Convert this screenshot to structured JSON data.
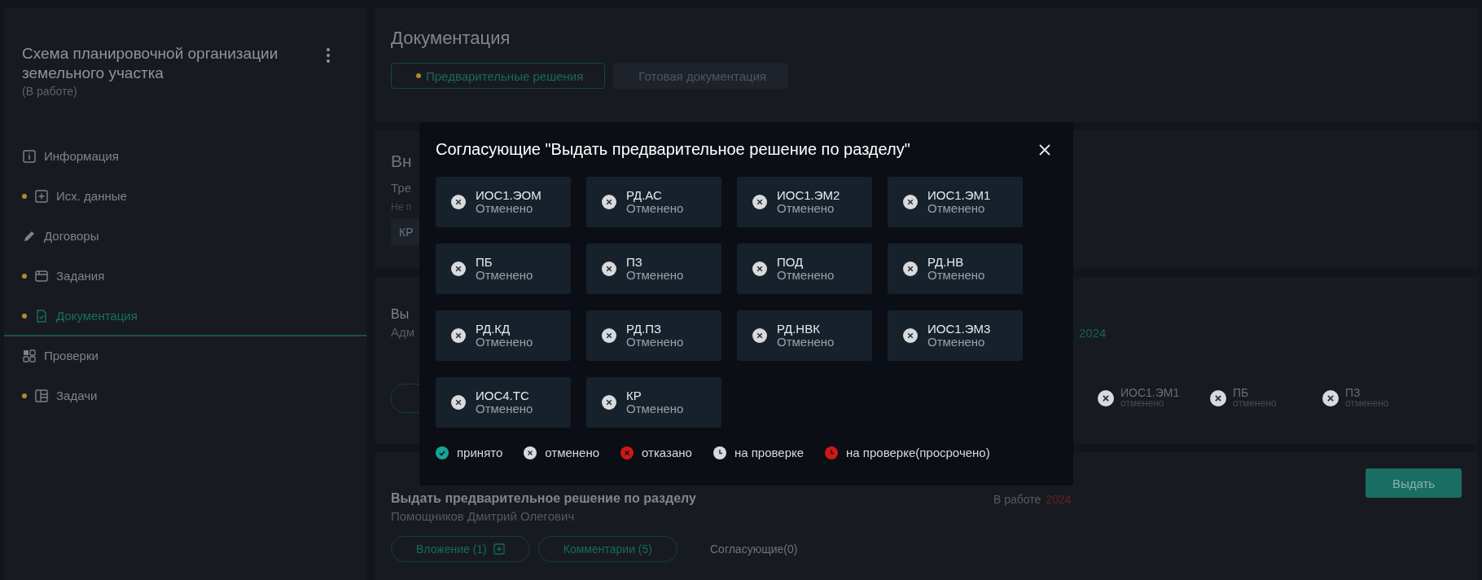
{
  "sidebar": {
    "title": "Схема планировочной организации земельного участка",
    "status": "(В работе)",
    "items": [
      {
        "label": "Информация",
        "marked": false,
        "selected": false
      },
      {
        "label": "Исх. данные",
        "marked": true,
        "selected": false
      },
      {
        "label": "Договоры",
        "marked": false,
        "selected": false
      },
      {
        "label": "Задания",
        "marked": true,
        "selected": false
      },
      {
        "label": "Документация",
        "marked": true,
        "selected": true
      },
      {
        "label": "Проверки",
        "marked": false,
        "selected": false
      },
      {
        "label": "Задачи",
        "marked": true,
        "selected": false
      }
    ]
  },
  "page": {
    "title": "Документация",
    "tabs": [
      {
        "label": "Предварительные решения",
        "marked": true,
        "selected": true
      },
      {
        "label": "Готовая документация",
        "marked": false,
        "selected": false
      }
    ]
  },
  "cards": [
    {
      "kind": "request",
      "title": "Вн",
      "subtitle": "Тре",
      "note": "Не п",
      "chip": "КР"
    },
    {
      "kind": "decision",
      "title": "Вы",
      "author": "Адм",
      "date": "2024",
      "approvers": [
        {
          "code": "ИОС1.ЭМ1",
          "status": "отменено",
          "kind": "cancelled"
        },
        {
          "code": "ПБ",
          "status": "отменено",
          "kind": "cancelled"
        },
        {
          "code": "ПЗ",
          "status": "отменено",
          "kind": "cancelled"
        }
      ]
    },
    {
      "kind": "issue",
      "title": "Выдать предварительное решение по разделу",
      "author": "Помощников Дмитрий Олегович",
      "status": "В работе",
      "date": "2024",
      "attachment": "Вложение (1)",
      "comments": "Комментарии (5)",
      "approvers_label": "Согласующие(0)",
      "action": "Выдать"
    }
  ],
  "modal": {
    "title": "Согласующие \"Выдать предварительное решение по разделу\"",
    "approvers": [
      {
        "code": "ИОС1.ЭОМ",
        "status": "Отменено",
        "kind": "cancelled"
      },
      {
        "code": "РД.АС",
        "status": "Отменено",
        "kind": "cancelled"
      },
      {
        "code": "ИОС1.ЭМ2",
        "status": "Отменено",
        "kind": "cancelled"
      },
      {
        "code": "ИОС1.ЭМ1",
        "status": "Отменено",
        "kind": "cancelled"
      },
      {
        "code": "ПБ",
        "status": "Отменено",
        "kind": "cancelled"
      },
      {
        "code": "ПЗ",
        "status": "Отменено",
        "kind": "cancelled"
      },
      {
        "code": "ПОД",
        "status": "Отменено",
        "kind": "cancelled"
      },
      {
        "code": "РД.НВ",
        "status": "Отменено",
        "kind": "cancelled"
      },
      {
        "code": "РД.КД",
        "status": "Отменено",
        "kind": "cancelled"
      },
      {
        "code": "РД.ПЗ",
        "status": "Отменено",
        "kind": "cancelled"
      },
      {
        "code": "РД.НВК",
        "status": "Отменено",
        "kind": "cancelled"
      },
      {
        "code": "ИОС1.ЭМ3",
        "status": "Отменено",
        "kind": "cancelled"
      },
      {
        "code": "ИОС4.ТС",
        "status": "Отменено",
        "kind": "cancelled"
      },
      {
        "code": "КР",
        "status": "Отменено",
        "kind": "cancelled"
      }
    ],
    "legend": [
      {
        "label": "принято",
        "kind": "accepted"
      },
      {
        "label": "отменено",
        "kind": "cancelled"
      },
      {
        "label": "отказано",
        "kind": "rejected"
      },
      {
        "label": "на проверке",
        "kind": "review"
      },
      {
        "label": "на проверке(просрочено)",
        "kind": "overdue"
      }
    ]
  }
}
